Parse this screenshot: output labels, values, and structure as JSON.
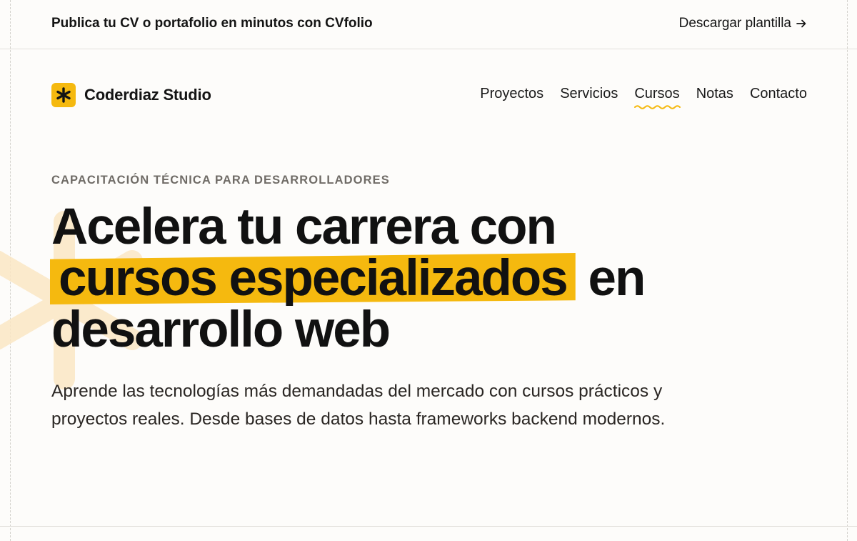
{
  "promo": {
    "text": "Publica tu CV o portafolio en minutos con CVfolio",
    "link_label": "Descargar plantilla",
    "link_icon": "arrow-right-icon"
  },
  "brand": {
    "logo_icon": "asterisk-icon",
    "name": "Coderdiaz Studio"
  },
  "nav": {
    "items": [
      {
        "label": "Proyectos"
      },
      {
        "label": "Servicios"
      },
      {
        "label": "Cursos",
        "active": true
      },
      {
        "label": "Notas"
      },
      {
        "label": "Contacto"
      }
    ]
  },
  "hero": {
    "eyebrow": "CAPACITACIÓN TÉCNICA PARA DESARROLLADORES",
    "headline_line1": "Acelera tu carrera con",
    "headline_highlight": "cursos especializados",
    "headline_after_highlight": "en",
    "headline_line3": "desarrollo web",
    "description": "Aprende las tecnologías más demandadas del mercado con cursos prácticos y proyectos reales. Desde bases de datos hasta frameworks backend modernos."
  },
  "colors": {
    "accent": "#f5b90f",
    "background": "#fdfcfa",
    "text": "#111111",
    "muted": "#6f6b66"
  }
}
